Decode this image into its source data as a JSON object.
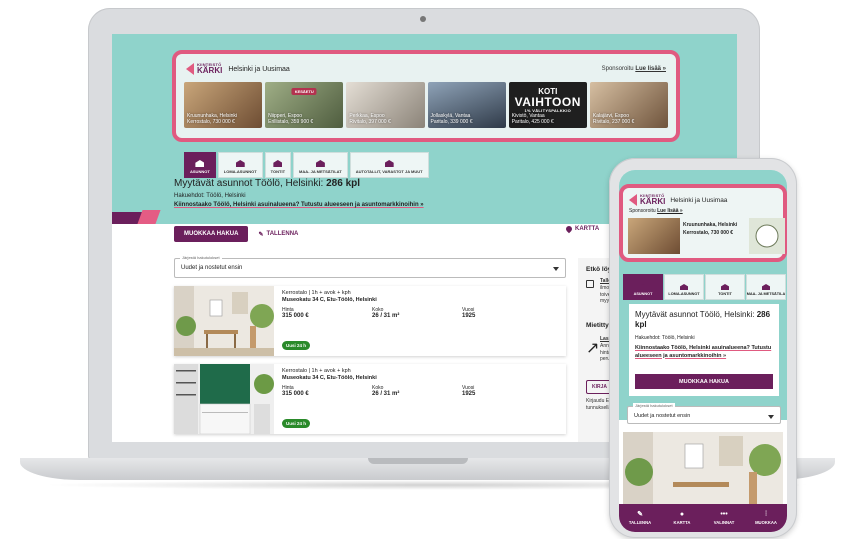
{
  "sponsor": {
    "brand": "KÄRKI",
    "brand_small": "KIINTEISTÖ",
    "region": "Helsinki ja Uusimaa",
    "sponsored": "Sponsoroitu",
    "read_more": "Lue lisää »",
    "tiles": [
      {
        "line1": "Kruununhaka, Helsinki",
        "line2": "Kerrostalo, 730 000 €",
        "color": "#8a6a4a"
      },
      {
        "line1": "Niipperi, Espoo",
        "line2": "Erillistalo, 359 900 €",
        "badge": "KESÄETU",
        "color": "#6d7a5a"
      },
      {
        "line1": "Perkkaa, Espoo",
        "line2": "Rivitalo, 397 000 €",
        "color": "#b7b0a6"
      },
      {
        "line1": "Jollaskylä, Vantaa",
        "line2": "Paritalo, 339 000 €",
        "color": "#4a5a6e"
      },
      {
        "line1": "Kivistö, Vantaa",
        "line2": "Paritalo, 425 000 €",
        "promo": [
          "KOTI",
          "VAIHTOON",
          "1% VÄLITYSPALKKIO"
        ],
        "color": "#2a2a2a"
      },
      {
        "line1": "Kalajärvi, Espoo",
        "line2": "Rivitalo, 237 000 €",
        "color": "#9a7b5e"
      }
    ]
  },
  "tabs": [
    {
      "label": "ASUNNOT",
      "active": true
    },
    {
      "label": "LOMA-ASUNNOT",
      "active": false
    },
    {
      "label": "TONTIT",
      "active": false
    },
    {
      "label": "MAA- JA METSÄTILAT",
      "active": false
    },
    {
      "label": "AUTOTALLIT, VARASTOT JA MUUT",
      "active": false
    }
  ],
  "results": {
    "title_prefix": "Myytävät asunnot Töölö, Helsinki:",
    "count": "286 kpl",
    "criteria": "Hakuehdot: Töölö, Helsinki",
    "area_link": "Kiinnostaako Töölö, Helsinki asuinalueena? Tutustu alueeseen ja asuntomarkkinoihin »",
    "edit_button": "MUOKKAA HAKUA",
    "save_link": "TALLENNA",
    "map_link": "KARTTA"
  },
  "sort": {
    "label": "Järjestä hakutulokset",
    "value": "Uudet ja nostetut ensin"
  },
  "listings": [
    {
      "type": "Kerrostalo | 1h + avok + kph",
      "address": "Museokatu 34 C, Etu-Töölö, Helsinki",
      "price_label": "Hinta",
      "price": "315 000 €",
      "size_label": "Koko",
      "size": "26 / 31 m²",
      "year_label": "Vuosi",
      "year": "1925",
      "badge": "Uusi 24 h"
    },
    {
      "type": "Kerrostalo | 1h + avok + kph",
      "address": "Museokatu 34 C, Etu-Töölö, Helsinki",
      "price_label": "Hinta",
      "price": "315 000 €",
      "size_label": "Koko",
      "size": "26 / 31 m²",
      "year_label": "Vuosi",
      "year": "1925",
      "badge": "Uusi 24 h"
    }
  ],
  "sidebar": {
    "title1": "Etkö löyt",
    "lines1": [
      "Tallen",
      "ilmo",
      "toive",
      "myyt"
    ],
    "title2": "Mietittyä",
    "lines2": [
      "Lask",
      "Anna",
      "hinta",
      "perus"
    ],
    "button": "KIRJA",
    "footer": [
      "Kirjaudu Et",
      "tunnuksella"
    ]
  },
  "phone": {
    "brand": "KÄRKI",
    "brand_small": "KIINTEISTÖ",
    "region": "Helsinki ja Uusimaa",
    "sponsored": "Sponsoroitu",
    "read_more": "Lue lisää »",
    "tile_line1": "Kruununhaka, Helsinki",
    "tile_line2": "Kerrostalo, 730 000 €",
    "tabs": [
      "ASUNNOT",
      "LOMA-ASUNNOT",
      "TONTIT",
      "MAA- JA METSÄTILA"
    ],
    "title_prefix": "Myytävät asunnot Töölö, Helsinki:",
    "count": "286 kpl",
    "criteria": "Hakuehdot: Töölö, Helsinki",
    "area_link": "Kiinnostaako Töölö, Helsinki asuinalueena? Tutustu alueeseen ja asuntomarkkinoihin »",
    "edit_button": "MUOKKAA HAKUA",
    "sort_label": "Järjestä hakutulokset",
    "sort_value": "Uudet ja nostetut ensin",
    "nav": [
      {
        "label": "TALLENNA",
        "icon": "edit-icon"
      },
      {
        "label": "KARTTA",
        "icon": "map-pin-icon"
      },
      {
        "label": "VALINNAT",
        "icon": "more-icon"
      },
      {
        "label": "MUOKKAA",
        "icon": "filter-icon"
      }
    ]
  },
  "colors": {
    "brand_purple": "#6b1f5c",
    "brand_pink": "#e05a80",
    "teal": "#8fd3cb",
    "new_badge": "#2a8a2a"
  }
}
